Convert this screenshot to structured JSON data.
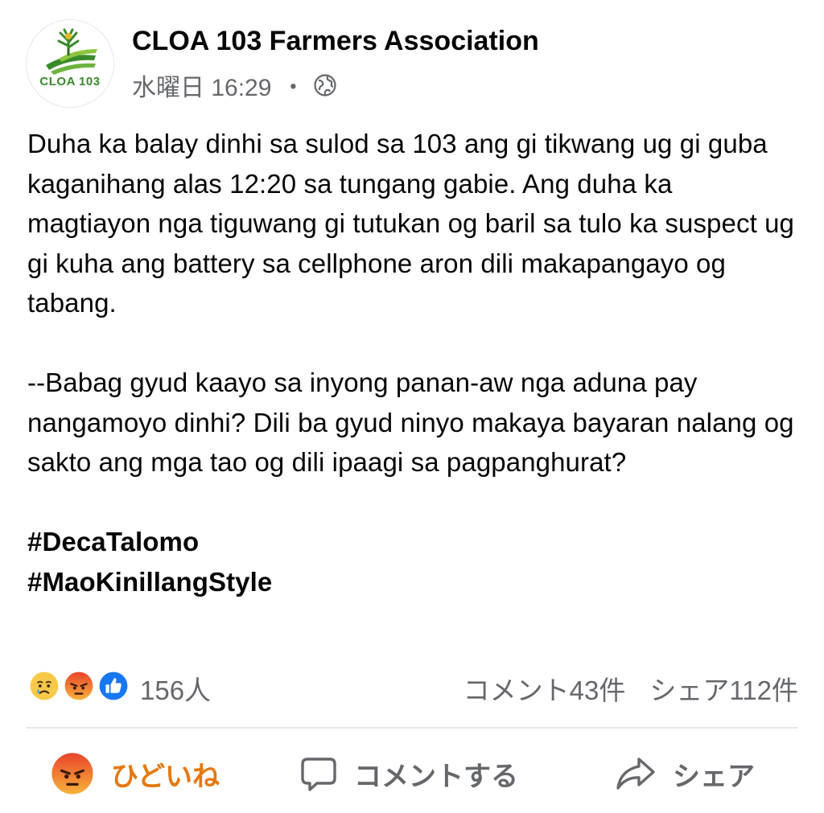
{
  "post": {
    "page_name": "CLOA 103 Farmers Association",
    "avatar_text": "CLOA 103",
    "timestamp": "水曜日 16:29",
    "separator": "・",
    "privacy_icon": "globe-icon",
    "body": {
      "paragraph1": "Duha ka balay dinhi sa sulod sa 103 ang gi tikwang ug gi guba kaganihang alas 12:20 sa tungang gabie. Ang duha ka magtiayon nga tiguwang gi tutukan og baril sa tulo ka suspect ug gi kuha ang battery sa cellphone aron dili makapangayo og tabang.",
      "paragraph2": "--Babag gyud kaayo sa inyong panan-aw nga aduna pay nangamoyo dinhi? Dili ba gyud ninyo makaya bayaran nalang og sakto ang mga tao og dili ipaagi sa pagpanghurat?",
      "hashtags": [
        "#DecaTalomo",
        "#MaoKinillangStyle"
      ]
    },
    "reactions": {
      "icons": [
        "sad-icon",
        "angry-icon",
        "like-icon"
      ],
      "count": "156人",
      "comments": "コメント43件",
      "shares": "シェア112件"
    },
    "actions": {
      "react_label": "ひどいね",
      "comment_label": "コメントする",
      "share_label": "シェア"
    },
    "colors": {
      "angry_active": "#e4780e",
      "like_blue": "#1877f2",
      "secondary_text": "#65676b",
      "brand_green": "#3a8a2a"
    }
  }
}
